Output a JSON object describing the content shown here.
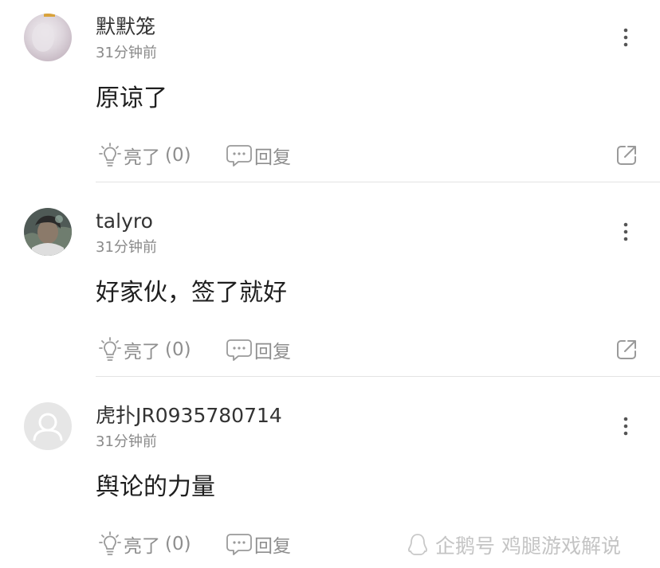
{
  "comments": [
    {
      "username": "默默笼",
      "time": "31分钟前",
      "content": "原谅了",
      "like_label": "亮了",
      "like_count": "(0)",
      "reply_label": "回复"
    },
    {
      "username": "talyro",
      "time": "31分钟前",
      "content": "好家伙，签了就好",
      "like_label": "亮了",
      "like_count": "(0)",
      "reply_label": "回复"
    },
    {
      "username": "虎扑JR0935780714",
      "time": "31分钟前",
      "content": "舆论的力量",
      "like_label": "亮了",
      "like_count": "(0)",
      "reply_label": "回复"
    }
  ],
  "watermark": {
    "text": "企鹅号 鸡腿游戏解说"
  },
  "colors": {
    "text_primary": "#1f1f1f",
    "text_secondary": "#8a8a8a",
    "action_gray": "#8e8e8e",
    "divider": "#e3e3e3",
    "watermark": "#c4c4c4"
  },
  "icons": [
    "lightbulb-icon",
    "comment-bubble-icon",
    "share-icon",
    "more-vertical-icon",
    "default-avatar-icon",
    "qq-penguin-icon"
  ]
}
